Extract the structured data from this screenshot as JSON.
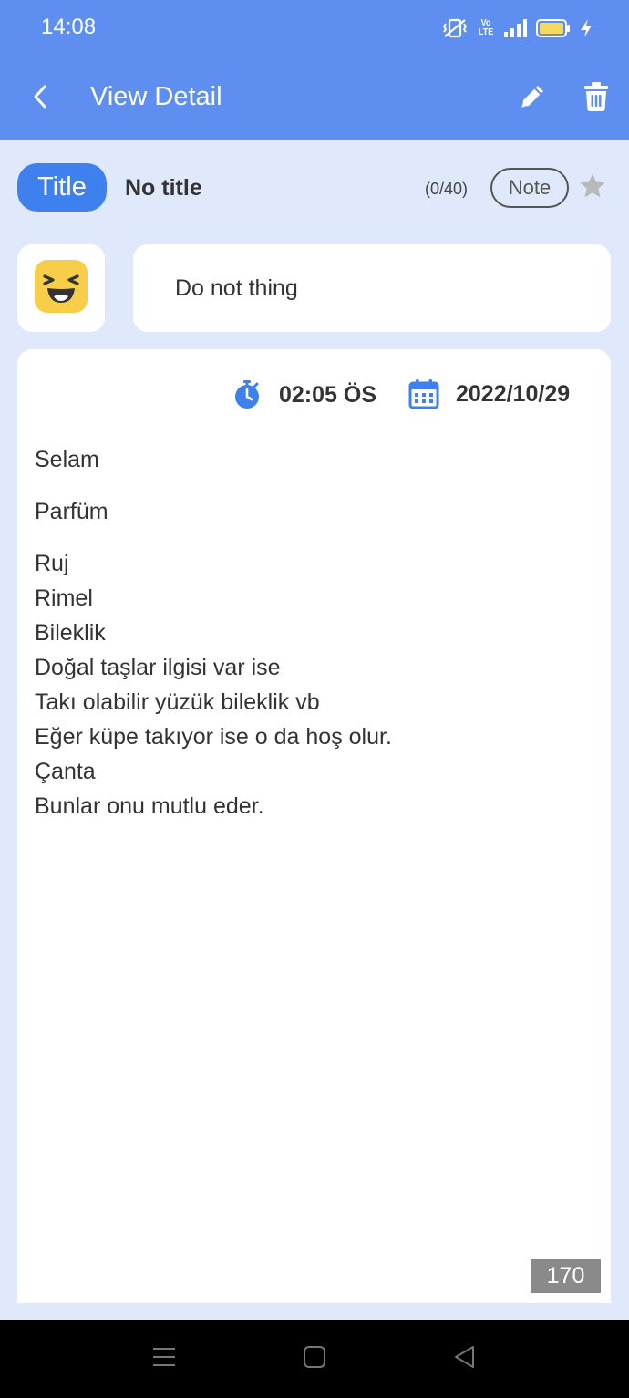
{
  "status_bar": {
    "time": "14:08",
    "volte_top": "Vo",
    "volte_bottom": "LTE",
    "icons": [
      "vibrate-icon",
      "volte-icon",
      "signal-icon",
      "battery-icon",
      "charging-icon"
    ]
  },
  "header": {
    "title": "View Detail",
    "back_icon": "chevron-left-icon",
    "edit_icon": "pencil-icon",
    "delete_icon": "trash-icon"
  },
  "title_row": {
    "badge_label": "Title",
    "title_value": "No title",
    "char_count": "(0/40)",
    "note_label": "Note",
    "star_icon": "star-icon",
    "starred": false
  },
  "mood": {
    "emoji_icon": "laughing-emoji-icon",
    "text": "Do not thing"
  },
  "entry": {
    "time": "02:05 ÖS",
    "date": "2022/10/29",
    "paragraphs": [
      [
        "Selam"
      ],
      [
        "Parfüm"
      ],
      [
        "Ruj",
        "Rimel",
        "Bileklik",
        "Doğal taşlar ilgisi var ise",
        "Takı olabilir yüzük bileklik vb",
        "Eğer küpe takıyor ise o da hoş olur.",
        "Çanta",
        "Bunlar onu mutlu eder."
      ]
    ],
    "word_count": "170"
  },
  "nav_bar": {
    "icons": [
      "menu-icon",
      "home-icon",
      "back-triangle-icon"
    ]
  },
  "colors": {
    "header": "#5e8ff0",
    "accent": "#3f80ef",
    "background": "#dfe9fb",
    "emoji_yellow": "#f7cd4a"
  }
}
